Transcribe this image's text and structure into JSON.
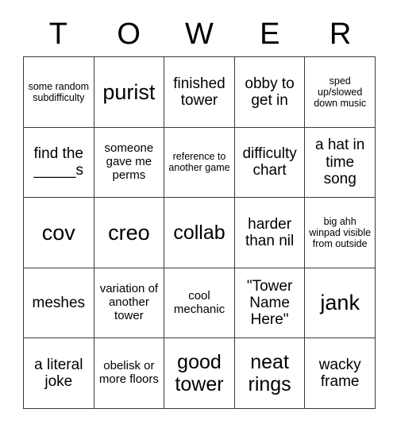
{
  "card": {
    "header_letters": [
      "T",
      "O",
      "W",
      "E",
      "R"
    ],
    "grid": {
      "columns": 5,
      "rows": 5,
      "line_color": "#3a3a3a",
      "background_color": "#ffffff",
      "text_color": "#000000"
    },
    "cells": [
      {
        "text": "some random subdifficulty",
        "size": "xs"
      },
      {
        "text": "purist",
        "size": "xl"
      },
      {
        "text": "finished tower",
        "size": "md"
      },
      {
        "text": "obby to get in",
        "size": "md"
      },
      {
        "text": "sped up/slowed down music",
        "size": "xs"
      },
      {
        "text": "find the _____s",
        "size": "md"
      },
      {
        "text": "someone gave me perms",
        "size": "sm"
      },
      {
        "text": "reference to another game",
        "size": "xs"
      },
      {
        "text": "difficulty chart",
        "size": "md"
      },
      {
        "text": "a hat in time song",
        "size": "md"
      },
      {
        "text": "cov",
        "size": "xl"
      },
      {
        "text": "creo",
        "size": "xl"
      },
      {
        "text": "collab",
        "size": "lg"
      },
      {
        "text": "harder than nil",
        "size": "md"
      },
      {
        "text": "big ahh winpad visible from outside",
        "size": "xs"
      },
      {
        "text": "meshes",
        "size": "md"
      },
      {
        "text": "variation of another tower",
        "size": "sm"
      },
      {
        "text": "cool mechanic",
        "size": "sm"
      },
      {
        "text": "\"Tower Name Here\"",
        "size": "md"
      },
      {
        "text": "jank",
        "size": "xl"
      },
      {
        "text": "a literal joke",
        "size": "md"
      },
      {
        "text": "obelisk or more floors",
        "size": "sm"
      },
      {
        "text": "good tower",
        "size": "lg"
      },
      {
        "text": "neat rings",
        "size": "lg"
      },
      {
        "text": "wacky frame",
        "size": "md"
      }
    ]
  }
}
